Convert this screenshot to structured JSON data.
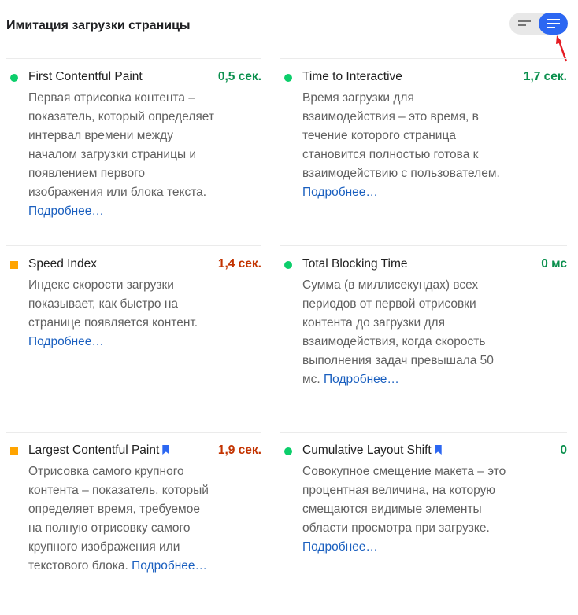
{
  "header": {
    "title": "Имитация загрузки страницы"
  },
  "toggle": {
    "left_icon": "list-compact-icon",
    "right_icon": "list-expanded-icon",
    "selected": "right"
  },
  "colors": {
    "pass": "#0cce6b",
    "average": "#ffa400",
    "accent": "#2c67f2",
    "link": "#1a5fbf"
  },
  "link_label": "Подробнее…",
  "metrics": [
    {
      "title": "First Contentful Paint",
      "value": "0,5 сек.",
      "status": "pass",
      "description": "Первая отрисовка контента – показатель, который определяет интервал времени между началом загрузки страницы и появлением первого изображения или блока текста."
    },
    {
      "title": "Time to Interactive",
      "value": "1,7 сек.",
      "status": "pass",
      "description": "Время загрузки для взаимодействия – это время, в течение которого страница становится полностью готова к взаимодействию с пользователем."
    },
    {
      "title": "Speed Index",
      "value": "1,4 сек.",
      "status": "average",
      "description": "Индекс скорости загрузки показывает, как быстро на странице появляется контент."
    },
    {
      "title": "Total Blocking Time",
      "value": "0 мс",
      "status": "pass",
      "description": "Сумма (в миллисекундах) всех периодов от первой отрисовки контента до загрузки для взаимодействия, когда скорость выполнения задач превышала 50 мс."
    },
    {
      "title": "Largest Contentful Paint",
      "value": "1,9 сек.",
      "status": "average",
      "bookmark": true,
      "description": "Отрисовка самого крупного контента – показатель, который определяет время, требуемое на полную отрисовку самого крупного изображения или текстового блока."
    },
    {
      "title": "Cumulative Layout Shift",
      "value": "0",
      "status": "pass",
      "bookmark": true,
      "description": "Совокупное смещение макета – это процентная величина, на которую смещаются видимые элементы области просмотра при загрузке."
    }
  ]
}
